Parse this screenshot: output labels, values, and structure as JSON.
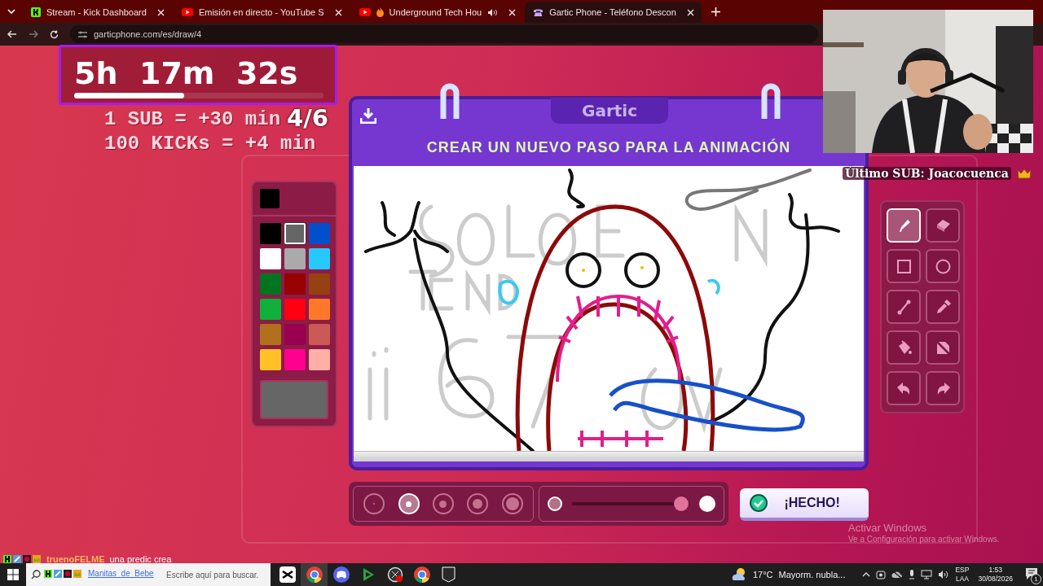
{
  "browser": {
    "tabs": [
      {
        "kind": "kick",
        "title": "Stream - Kick Dashboard",
        "selected": false,
        "audio": false,
        "flame": false
      },
      {
        "kind": "youtube",
        "title": "Emisión en directo - YouTube S",
        "selected": false,
        "audio": false,
        "flame": false
      },
      {
        "kind": "youtube",
        "title": "Underground Tech Hou",
        "selected": false,
        "audio": true,
        "flame": true
      },
      {
        "kind": "gartic",
        "title": "Gartic Phone - Teléfono Descon",
        "selected": true,
        "audio": false,
        "flame": false
      }
    ],
    "url": "garticphone.com/es/draw/4"
  },
  "card": {
    "logo": "Gartic",
    "heading": "CREAR UN NUEVO PASO PARA LA ANIMACIÓN"
  },
  "palette": {
    "colors": [
      {
        "color": "#000000",
        "selected": false
      },
      {
        "color": "#666666",
        "selected": true
      },
      {
        "color": "#0050cd",
        "selected": false
      },
      {
        "color": "#ffffff",
        "selected": false
      },
      {
        "color": "#aaaaaa",
        "selected": false
      },
      {
        "color": "#26c9ff",
        "selected": false
      },
      {
        "color": "#017420",
        "selected": false
      },
      {
        "color": "#990000",
        "selected": false
      },
      {
        "color": "#964112",
        "selected": false
      },
      {
        "color": "#11b03c",
        "selected": false
      },
      {
        "color": "#ff0013",
        "selected": false
      },
      {
        "color": "#ff7829",
        "selected": false
      },
      {
        "color": "#b0701c",
        "selected": false
      },
      {
        "color": "#99004e",
        "selected": false
      },
      {
        "color": "#cb5a57",
        "selected": false
      },
      {
        "color": "#ffc126",
        "selected": false
      },
      {
        "color": "#ff008f",
        "selected": false
      },
      {
        "color": "#feafa8",
        "selected": false
      }
    ]
  },
  "tools": [
    {
      "kind": "pen",
      "selected": true
    },
    {
      "kind": "eraser",
      "selected": false
    },
    {
      "kind": "rectangle",
      "selected": false
    },
    {
      "kind": "ellipse",
      "selected": false
    },
    {
      "kind": "line",
      "selected": false
    },
    {
      "kind": "eyedropper",
      "selected": false
    },
    {
      "kind": "fill",
      "selected": false
    },
    {
      "kind": "clear",
      "selected": false
    },
    {
      "kind": "undo",
      "selected": false
    },
    {
      "kind": "redo",
      "selected": false
    }
  ],
  "brush_sizes": [
    {
      "selected": false
    },
    {
      "selected": true
    },
    {
      "selected": false
    },
    {
      "selected": false
    },
    {
      "selected": false
    }
  ],
  "opacity": {
    "level": 0.93
  },
  "done_button": "¡HECHO!",
  "stream": {
    "timer": {
      "text": "5h  17m  32s",
      "level": 0.44
    },
    "round": "4/6",
    "rules": [
      "1 SUB = +30 min",
      "100 KICKs = +4 min"
    ],
    "last_sub": "Último SUB: Joacocuenca",
    "chat": [
      {
        "user": "truenoFELME",
        "message": "una predic crea"
      },
      {
        "user": "Manitas_de_Bebe"
      }
    ]
  },
  "activation": [
    "Activar Windows",
    "Ve a Configuración para activar Windows."
  ],
  "taskbar": {
    "search_placeholder": "Escribe aquí para buscar.",
    "apps": [
      {
        "kind": "capcut",
        "active": false
      },
      {
        "kind": "chrome",
        "active": true
      },
      {
        "kind": "discord",
        "active": false
      },
      {
        "kind": "player",
        "active": false
      },
      {
        "kind": "recorder",
        "active": false
      },
      {
        "kind": "chrome",
        "active": false
      },
      {
        "kind": "epic",
        "active": false
      }
    ],
    "weather": {
      "temp": "17°C",
      "desc": "Mayorm. nubla..."
    },
    "language": [
      "ESP",
      "LAA"
    ],
    "time": "1:53",
    "date": "30/08/2026",
    "notifications": "1"
  }
}
